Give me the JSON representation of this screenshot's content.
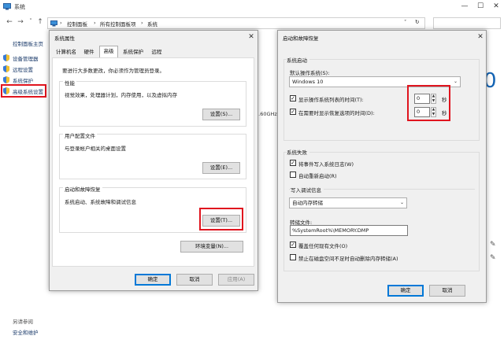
{
  "window": {
    "title": "系统",
    "minimize_glyph": "—",
    "maximize_glyph": "☐",
    "close_glyph": "✕"
  },
  "address_bar": {
    "back_glyph": "←",
    "forward_glyph": "→",
    "recent_glyph": "˅",
    "up_glyph": "↑",
    "crumbs": [
      "控制面板",
      "所有控制面板项",
      "系统"
    ],
    "separator": "›",
    "dropdown_glyph": "˅",
    "refresh_glyph": "↻"
  },
  "sidebar": {
    "home": "控制面板主页",
    "items": [
      "设备管理器",
      "远程设置",
      "系统保护",
      "高级系统设置"
    ],
    "see_also": "另请参阅",
    "security": "安全和维护"
  },
  "background": {
    "big_digit": "0",
    "cpu_fragment": "3.60GHz",
    "edit_glyph": "✎"
  },
  "sys_props": {
    "title": "系统属性",
    "close_glyph": "✕",
    "tabs": [
      "计算机名",
      "硬件",
      "高级",
      "系统保护",
      "远程"
    ],
    "admin_note": "要进行大多数更改，你必须作为管理员登录。",
    "perf": {
      "title": "性能",
      "desc": "视觉效果，处理器计划，内存使用，以及虚拟内存",
      "button": "设置(S)..."
    },
    "profile": {
      "title": "用户配置文件",
      "desc": "与登录帐户相关的桌面设置",
      "button": "设置(E)..."
    },
    "startup": {
      "title": "启动和故障恢复",
      "desc": "系统启动、系统故障和调试信息",
      "button": "设置(T)..."
    },
    "env_button": "环境变量(N)...",
    "ok": "确定",
    "cancel": "取消",
    "apply": "应用(A)"
  },
  "startup_dialog": {
    "title": "启动和故障恢复",
    "close_glyph": "✕",
    "system_startup": "系统启动",
    "default_os_label": "默认操作系统(S):",
    "default_os_value": "Windows 10",
    "dropdown_glyph": "⌄",
    "show_os_list": {
      "label": "显示操作系统列表的时间(T):",
      "checked": true,
      "value": "0",
      "unit": "秒"
    },
    "show_recovery": {
      "label": "在需要时显示恢复选项的时间(D):",
      "checked": true,
      "value": "0",
      "unit": "秒"
    },
    "system_failure": "系统失败",
    "write_log": {
      "label": "将事件写入系统日志(W)",
      "checked": true
    },
    "auto_restart": {
      "label": "自动重新启动(R)",
      "checked": false
    },
    "debug_info": "写入调试信息",
    "debug_type": "自动内存转储",
    "dump_file_label": "转储文件:",
    "dump_file_value": "%SystemRoot%\\MEMORY.DMP",
    "overwrite": {
      "label": "覆盖任何现有文件(O)",
      "checked": true
    },
    "disable_auto_delete": {
      "label": "禁止在磁盘空间不足时自动删除内存转储(A)",
      "checked": false
    },
    "ok": "确定",
    "cancel": "取消",
    "check_glyph": "✓",
    "spin_up": "▲",
    "spin_down": "▼"
  },
  "colors": {
    "highlight_red": "#e0141e",
    "link_blue": "#1a3a6a",
    "accent": "#0078d7"
  }
}
